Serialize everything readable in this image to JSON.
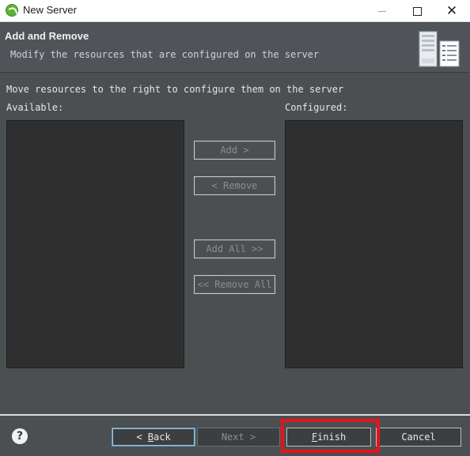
{
  "window": {
    "title": "New Server",
    "app_icon": "spring-leaf-icon"
  },
  "banner": {
    "title": "Add and Remove",
    "description": "Modify the resources that are configured on the server",
    "icon": "server-icon"
  },
  "main": {
    "instruction": "Move resources to the right to configure them on the server",
    "available_label": "Available:",
    "configured_label": "Configured:",
    "available_items": [],
    "configured_items": []
  },
  "actions": {
    "add": "Add >",
    "remove": "< Remove",
    "add_all": "Add All >>",
    "remove_all": "<< Remove All"
  },
  "footer": {
    "help_icon": "help-icon",
    "back_prefix": "< ",
    "back_mnemonic": "B",
    "back_rest": "ack",
    "next": "Next >",
    "finish_mnemonic": "F",
    "finish_rest": "inish",
    "cancel": "Cancel"
  },
  "colors": {
    "background": "#4b4f52",
    "list_background": "#2f2f2f",
    "highlight": "#e8121b",
    "focus_border": "#4a9fe0"
  }
}
